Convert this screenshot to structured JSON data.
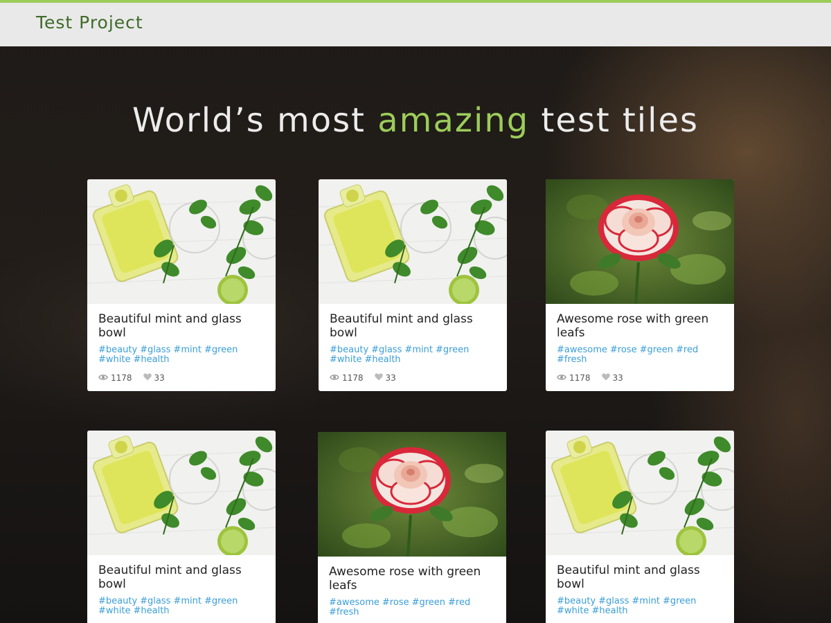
{
  "header": {
    "brand": "Test Project"
  },
  "hero": {
    "title_before": "World’s most ",
    "title_accent": "amazing",
    "title_after": " test tiles"
  },
  "colors": {
    "accent": "#9ccc5a",
    "tag": "#3a9ed8",
    "brand": "#3f6b2a"
  },
  "tiles": [
    {
      "image": "mint-glass-bowl",
      "title": "Beautiful mint and glass bowl",
      "tags": [
        "#beauty",
        "#glass",
        "#mint",
        "#green",
        "#white",
        "#health"
      ],
      "views": "1178",
      "likes": "33"
    },
    {
      "image": "mint-glass-bowl",
      "title": "Beautiful mint and glass bowl",
      "tags": [
        "#beauty",
        "#glass",
        "#mint",
        "#green",
        "#white",
        "#health"
      ],
      "views": "1178",
      "likes": "33"
    },
    {
      "image": "red-rose",
      "title": "Awesome rose with green leafs",
      "tags": [
        "#awesome",
        "#rose",
        "#green",
        "#red",
        "#fresh"
      ],
      "views": "1178",
      "likes": "33"
    },
    {
      "image": "mint-glass-bowl",
      "title": "Beautiful mint and glass bowl",
      "tags": [
        "#beauty",
        "#glass",
        "#mint",
        "#green",
        "#white",
        "#health"
      ],
      "views": "",
      "likes": ""
    },
    {
      "image": "red-rose",
      "title": "Awesome rose with green leafs",
      "tags": [
        "#awesome",
        "#rose",
        "#green",
        "#red",
        "#fresh"
      ],
      "views": "",
      "likes": ""
    },
    {
      "image": "mint-glass-bowl",
      "title": "Beautiful mint and glass bowl",
      "tags": [
        "#beauty",
        "#glass",
        "#mint",
        "#green",
        "#white",
        "#health"
      ],
      "views": "",
      "likes": ""
    }
  ]
}
